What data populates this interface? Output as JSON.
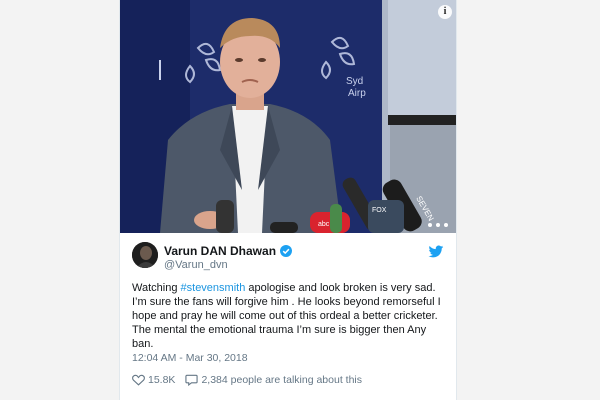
{
  "tweet": {
    "author_name": "Varun DAN Dhawan",
    "author_handle": "@Varun_dvn",
    "text_prefix": "Watching ",
    "hashtag": "#stevensmith",
    "text_suffix": " apologise and look broken is very sad. I’m sure the fans will forgive him . He looks beyond remorseful I hope and pray he will come out of this ordeal a better cricketer. The mental the emotional trauma I’m sure is bigger then Any ban.",
    "timestamp": "12:04 AM - Mar 30, 2018",
    "likes": "15.8K",
    "talking": "2,384 people are talking about this"
  },
  "media": {
    "info_label": "i"
  },
  "colors": {
    "link": "#1b95e0",
    "text": "#14171a",
    "muted": "#657786",
    "verified": "#1da1f2",
    "twitter_blue": "#1da1f2"
  },
  "icons": {
    "verified": "verified-badge-icon",
    "bird": "twitter-bird-icon",
    "heart": "heart-icon",
    "comment": "comment-bubble-icon",
    "info": "info-icon"
  }
}
